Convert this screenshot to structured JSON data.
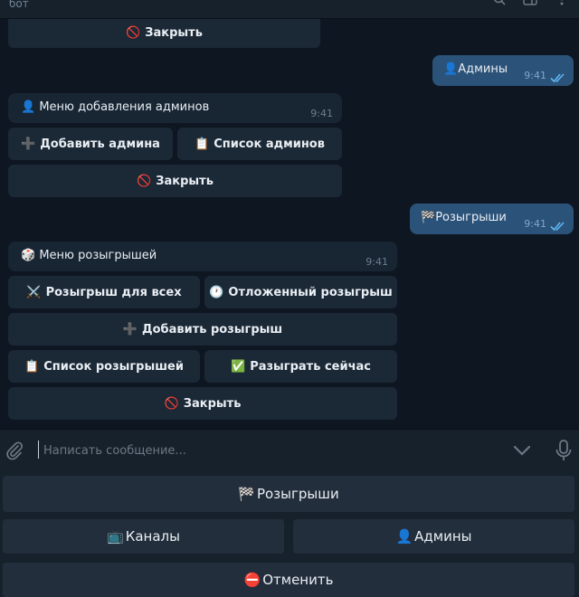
{
  "header": {
    "status": "бот"
  },
  "colors": {
    "background": "#0e1621",
    "incoming_bubble": "#182533",
    "outgoing_bubble": "#2b5278",
    "inline_button": "#1b2836",
    "keyboard_button": "#232e3c",
    "read_check": "#5fb7f5"
  },
  "messages": {
    "prev_close": {
      "emoji": "🚫",
      "label": "Закрыть"
    },
    "user_admins": {
      "emoji": "👤",
      "text": "Админы",
      "time": "9:41"
    },
    "admin_menu": {
      "emoji": "👤",
      "text": "Меню добавления админов",
      "time": "9:41",
      "buttons": {
        "add": {
          "emoji": "➕",
          "label": "Добавить админа"
        },
        "list": {
          "emoji": "📋",
          "label": "Список админов"
        },
        "close": {
          "emoji": "🚫",
          "label": "Закрыть"
        }
      }
    },
    "user_giveaways": {
      "emoji": "🏁",
      "text": "Розыгрыши",
      "time": "9:41"
    },
    "giveaway_menu": {
      "emoji": "🎲",
      "text": "Меню розыгрышей",
      "time": "9:41",
      "buttons": {
        "for_all": {
          "emoji": "⚔️",
          "label": "Розыгрыш для всех"
        },
        "delayed": {
          "emoji": "🕐",
          "label": "Отложенный розыгрыш"
        },
        "add": {
          "emoji": "➕",
          "label": "Добавить розыгрыш"
        },
        "list": {
          "emoji": "📋",
          "label": "Список розыгрышей"
        },
        "now": {
          "emoji": "✅",
          "label": "Разыграть сейчас"
        },
        "close": {
          "emoji": "🚫",
          "label": "Закрыть"
        }
      }
    }
  },
  "composer": {
    "placeholder": "Написать сообщение..."
  },
  "keyboard": {
    "giveaways": {
      "emoji": "🏁",
      "label": "Розыгрыши"
    },
    "channels": {
      "emoji": "📺",
      "label": "Каналы"
    },
    "admins": {
      "emoji": "👤",
      "label": "Админы"
    },
    "cancel": {
      "emoji": "⛔",
      "label": "Отменить"
    }
  }
}
